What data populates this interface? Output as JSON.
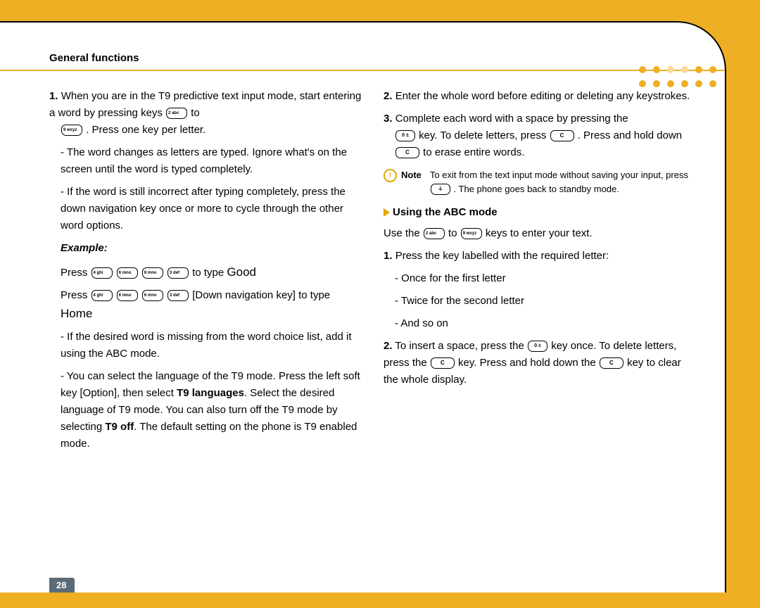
{
  "header": {
    "title": "General functions"
  },
  "left": {
    "p1a": "When you are in the T9 predictive text input mode, start entering a word by pressing keys ",
    "p1b": " to ",
    "p1c": " . Press one key per letter.",
    "bullet1": "The word changes as letters are typed. Ignore what's on the screen until the word is typed completely.",
    "bullet2": "If the word is still incorrect after typing completely, press the down navigation key once or more to cycle through the other word options.",
    "example_label": "Example:",
    "ex1a": "Press ",
    "ex1b": " to type ",
    "ex1_word": "Good",
    "ex2a": "Press ",
    "ex2b": " [Down navigation key] to type ",
    "ex2_word": "Home",
    "bullet3": "If the desired word is missing from the word choice list, add it using the ABC mode.",
    "bullet4a": "You can select the language of the T9 mode. Press the left soft key [Option], then select ",
    "bullet4_bold1": "T9 languages",
    "bullet4b": ". Select the desired language of T9 mode. You can also turn off the T9 mode by selecting ",
    "bullet4_bold2": "T9 off",
    "bullet4c": ". The default setting on the phone is T9 enabled mode."
  },
  "right": {
    "p2": "Enter the whole word before editing or deleting any keystrokes.",
    "p3a": "Complete each word with a space by pressing the ",
    "p3b": " key. To delete letters, press ",
    "p3c": " . Press and hold down ",
    "p3d": " to erase entire words.",
    "note_label": "Note",
    "note_a": "To exit from the text input mode without saving your input, press ",
    "note_b": " . The phone goes back to standby mode.",
    "subhead": "Using the ABC mode",
    "use_a": "Use the ",
    "use_b": " to ",
    "use_c": " keys to enter your text.",
    "r1": "Press the key labelled with the required letter:",
    "r1a": "Once for the first letter",
    "r1b": "Twice for the second letter",
    "r1c": "And so on",
    "r2a": "To insert a space, press the ",
    "r2b": " key once. To delete letters, press the ",
    "r2c": " key. Press and hold down the ",
    "r2d": " key to clear the whole display."
  },
  "keys": {
    "k2": "2 abc",
    "k3": "3 def",
    "k4": "4 ghi",
    "k6": "6 mno",
    "k9": "9 wxyz",
    "k0": "0 ±",
    "kc": "C",
    "kend": "⏚"
  },
  "page_number": "28"
}
